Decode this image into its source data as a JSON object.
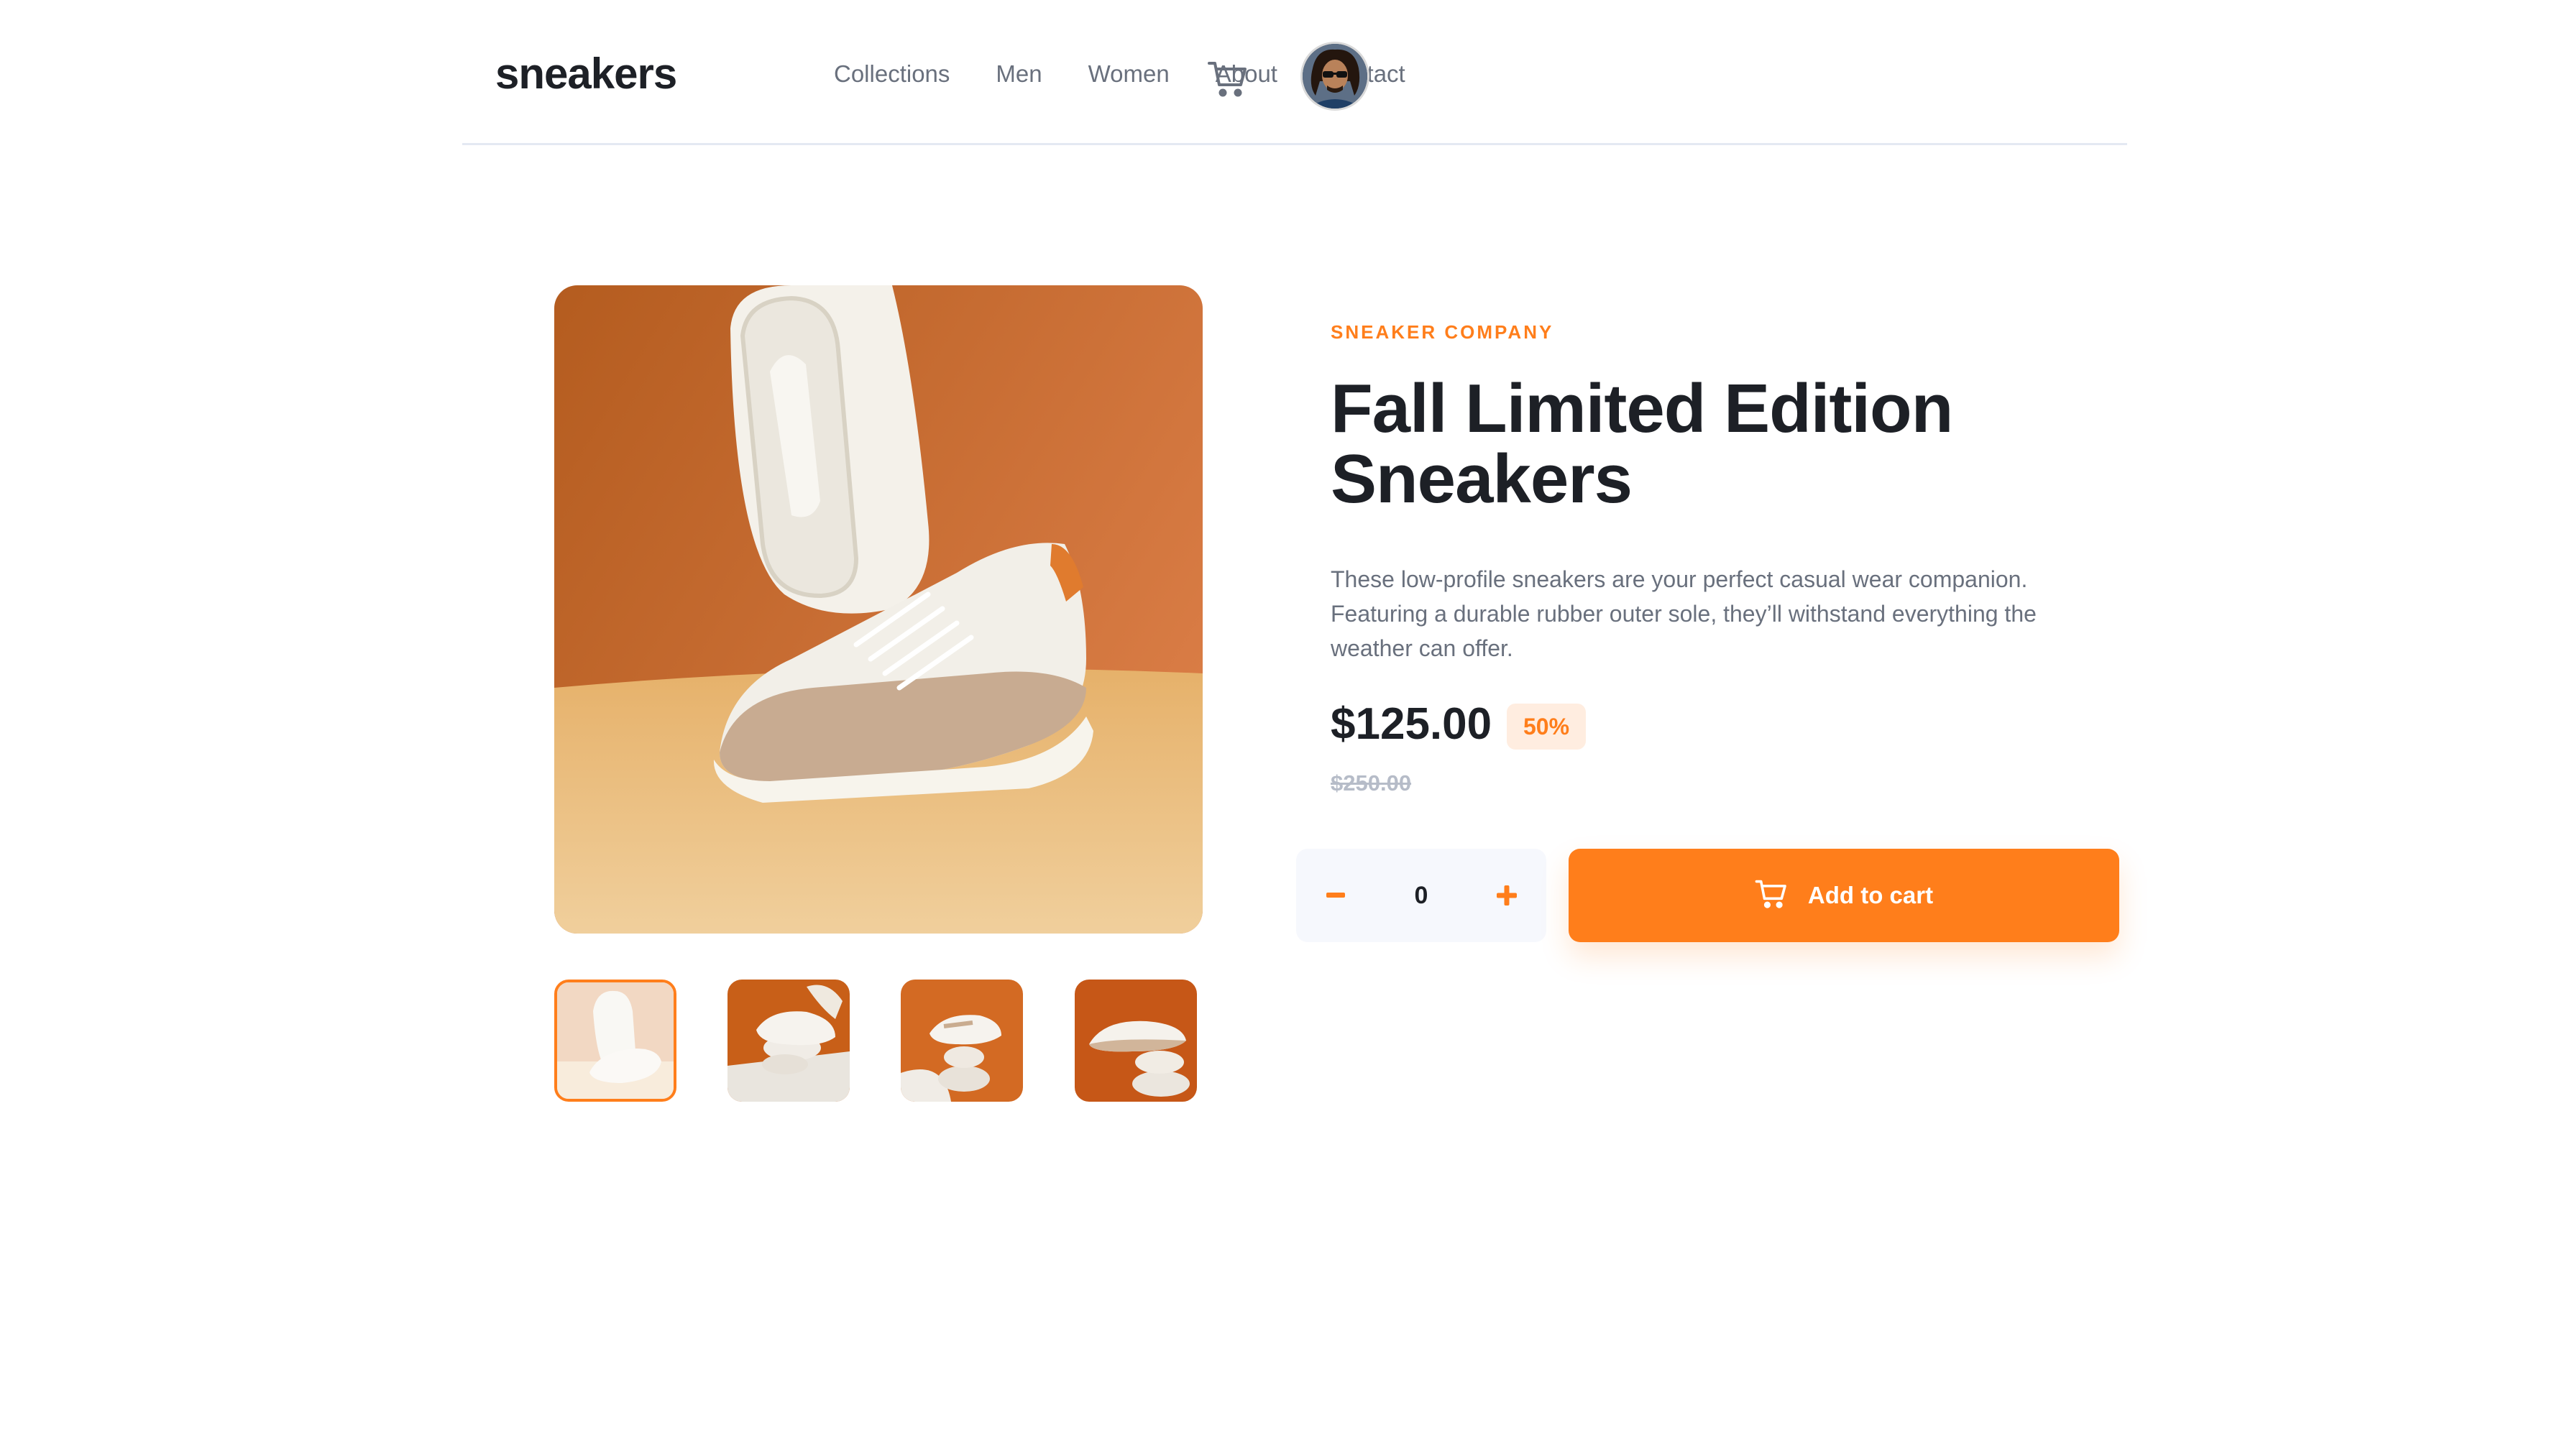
{
  "header": {
    "logo": "sneakers",
    "nav": [
      "Collections",
      "Men",
      "Women",
      "About",
      "Contact"
    ],
    "cart_icon": "cart-icon",
    "avatar_icon": "user-avatar"
  },
  "gallery": {
    "main_image": "white-beige-sneakers-on-orange-background",
    "thumbnails": [
      "thumbnail-1",
      "thumbnail-2",
      "thumbnail-3",
      "thumbnail-4"
    ],
    "active_index": 0
  },
  "product": {
    "company": "SNEAKER COMPANY",
    "title_line1": "Fall Limited Edition",
    "title_line2": "Sneakers",
    "description": "These low-profile sneakers are your perfect casual wear companion. Featuring a durable rubber outer sole, they’ll withstand everything the weather can offer.",
    "price": "$125.00",
    "discount": "50%",
    "original_price": "$250.00"
  },
  "cart": {
    "quantity": "0",
    "minus_icon": "minus-icon",
    "plus_icon": "plus-icon",
    "add_label": "Add to cart"
  },
  "colors": {
    "accent": "#ff7e1b",
    "accent_light": "#ffede0",
    "text_dark": "#1d2026",
    "text_muted": "#69707d",
    "text_faint": "#b6bcc8",
    "stepper_bg": "#f6f8fd"
  }
}
